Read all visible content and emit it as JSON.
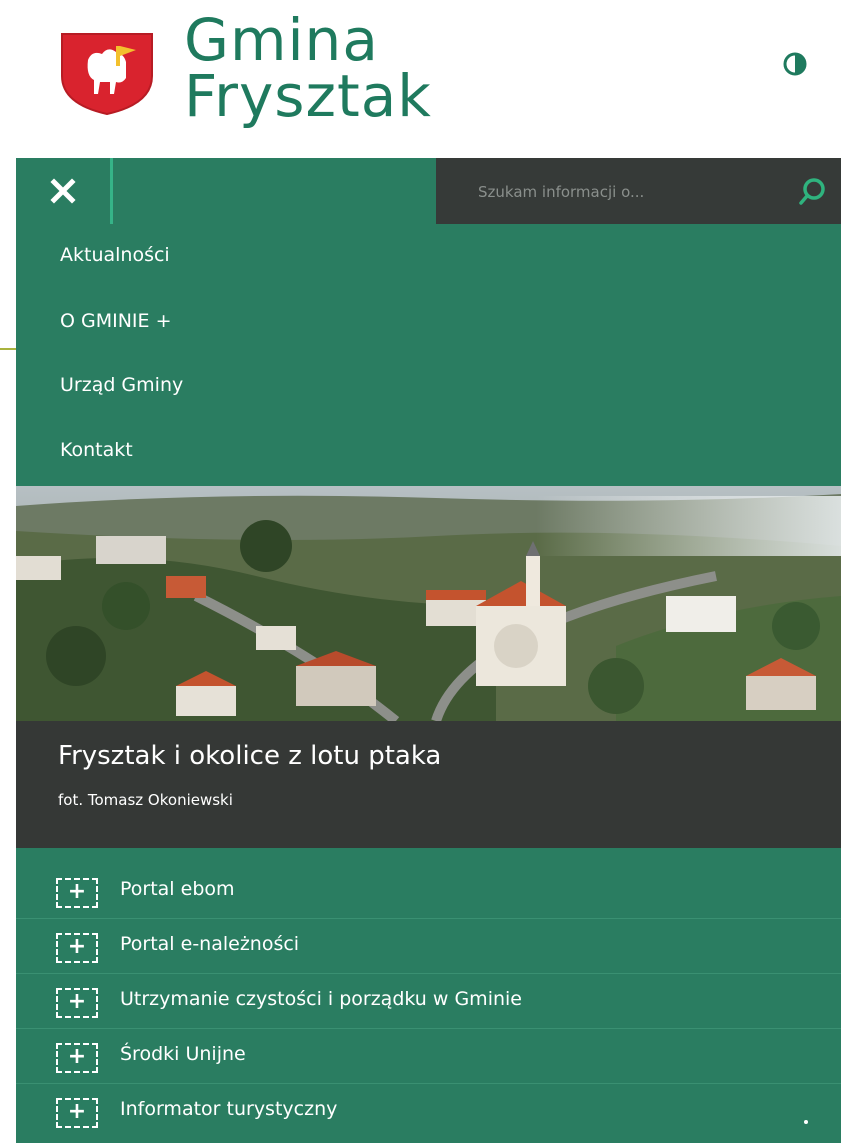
{
  "header": {
    "title_line1": "Gmina",
    "title_line2": "Frysztak",
    "contrast_icon": "contrast-toggle-icon",
    "crest_icon": "coat-of-arms-icon"
  },
  "nav": {
    "close_icon": "close-icon",
    "search_placeholder": "Szukam informacji o...",
    "search_icon": "search-icon",
    "items": [
      {
        "label": "Aktualności"
      },
      {
        "label": "O GMINIE +"
      },
      {
        "label": "Urząd Gminy"
      },
      {
        "label": "Kontakt"
      }
    ]
  },
  "hero": {
    "title": "Frysztak i okolice z lotu ptaka",
    "credit": "fot. Tomasz Okoniewski"
  },
  "links": [
    {
      "label": "Portal ebom"
    },
    {
      "label": "Portal e-należności"
    },
    {
      "label": "Utrzymanie czystości i porządku w Gminie"
    },
    {
      "label": "Środki Unijne"
    },
    {
      "label": "Informator turystyczny"
    }
  ],
  "colors": {
    "brand_green": "#2a7d61",
    "title_green": "#1f7a5e",
    "dark_panel": "#353836",
    "accent_line": "#a9b33e"
  }
}
